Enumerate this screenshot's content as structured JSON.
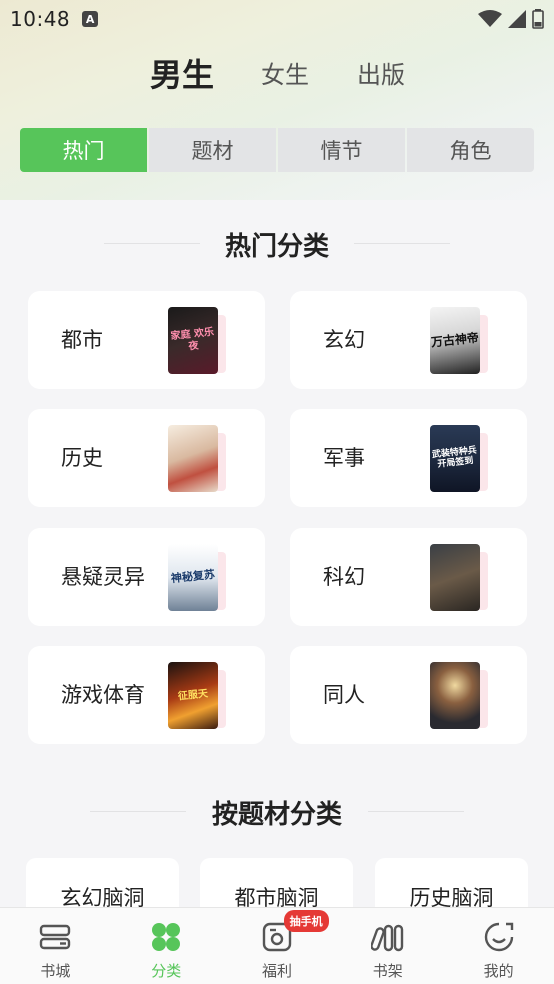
{
  "status": {
    "time": "10:48",
    "notif_icon": "A"
  },
  "gender_tabs": [
    {
      "label": "男生",
      "active": true
    },
    {
      "label": "女生",
      "active": false
    },
    {
      "label": "出版",
      "active": false
    }
  ],
  "segments": [
    {
      "label": "热门",
      "active": true
    },
    {
      "label": "题材",
      "active": false
    },
    {
      "label": "情节",
      "active": false
    },
    {
      "label": "角色",
      "active": false
    }
  ],
  "hot_section": {
    "title": "热门分类",
    "categories": [
      {
        "label": "都市",
        "cover_text": "家庭 欢乐夜"
      },
      {
        "label": "玄幻",
        "cover_text": "万古神帝"
      },
      {
        "label": "历史",
        "cover_text": ""
      },
      {
        "label": "军事",
        "cover_text": "武装特种兵 开局签到"
      },
      {
        "label": "悬疑灵异",
        "cover_text": "神秘复苏"
      },
      {
        "label": "科幻",
        "cover_text": ""
      },
      {
        "label": "游戏体育",
        "cover_text": "征服天"
      },
      {
        "label": "同人",
        "cover_text": ""
      }
    ]
  },
  "theme_section": {
    "title": "按题材分类",
    "items": [
      "玄幻脑洞",
      "都市脑洞",
      "历史脑洞"
    ]
  },
  "bottom_nav": {
    "items": [
      {
        "label": "书城",
        "icon": "bookstore-icon",
        "active": false
      },
      {
        "label": "分类",
        "icon": "category-icon",
        "active": true
      },
      {
        "label": "福利",
        "icon": "welfare-icon",
        "active": false,
        "badge": "抽手机"
      },
      {
        "label": "书架",
        "icon": "bookshelf-icon",
        "active": false
      },
      {
        "label": "我的",
        "icon": "profile-icon",
        "active": false
      }
    ]
  },
  "colors": {
    "accent": "#57c55a",
    "badge": "#e53935"
  }
}
